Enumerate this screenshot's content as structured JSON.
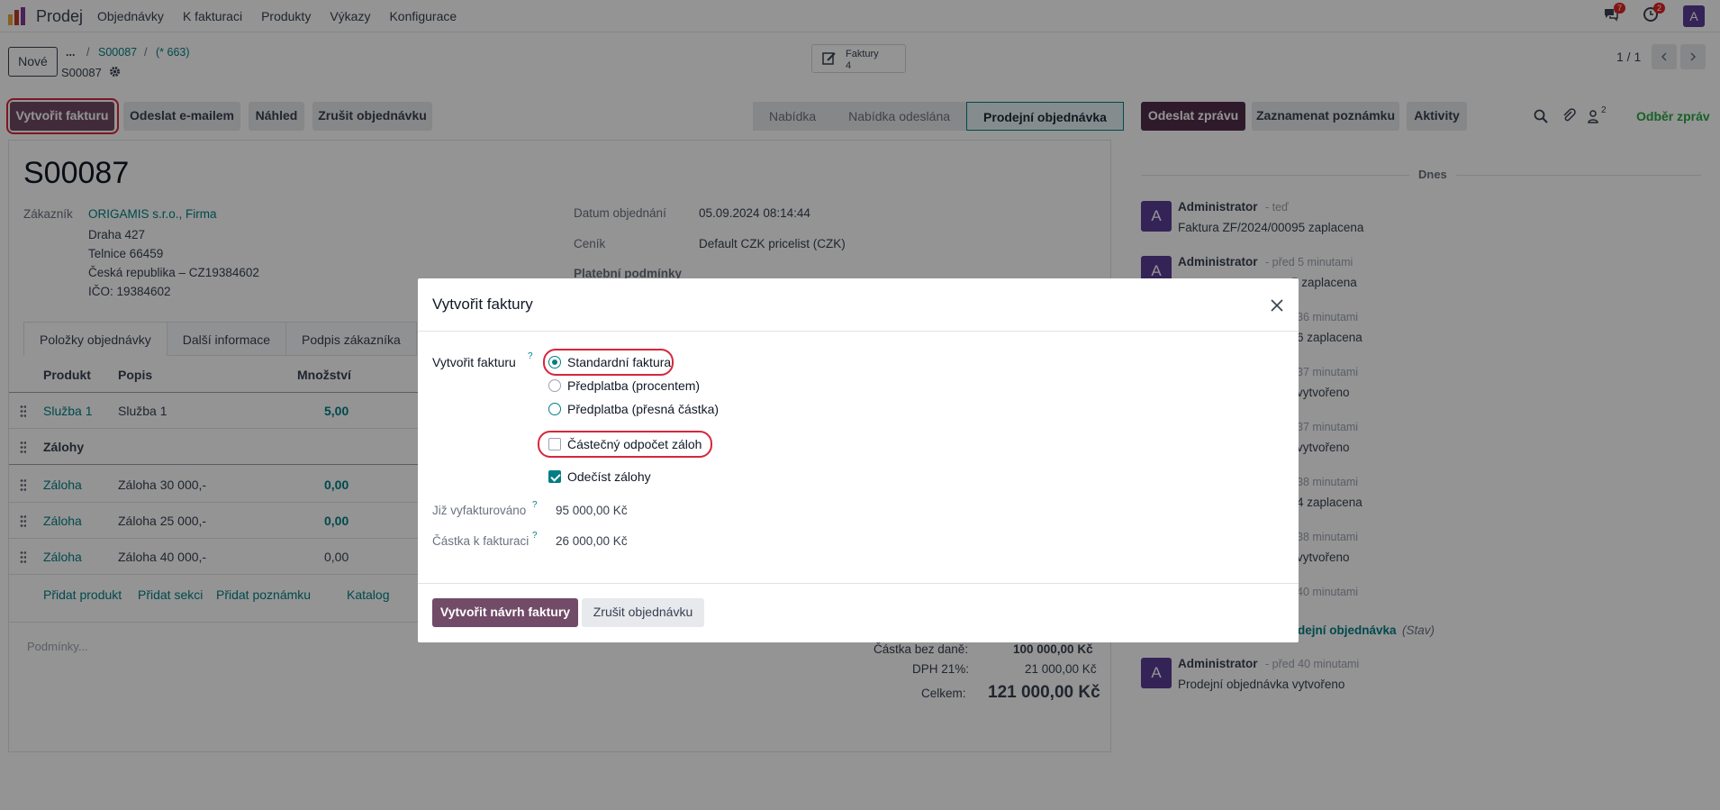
{
  "navbar": {
    "app_name": "Prodej",
    "menu": [
      "Objednávky",
      "K fakturaci",
      "Produkty",
      "Výkazy",
      "Konfigurace"
    ],
    "messages_count": "7",
    "activities_count": "2",
    "user_initial": "A"
  },
  "control": {
    "new_button": "Nové",
    "breadcrumb_ellipsis": "...",
    "breadcrumb_sep": "/",
    "breadcrumb_order": "S00087",
    "breadcrumb_count": "(* 663)",
    "record_name": "S00087",
    "invoices_label": "Faktury",
    "invoices_count": "4",
    "pager": "1 / 1"
  },
  "actions": {
    "create_invoice": "Vytvořit fakturu",
    "send_email": "Odeslat e-mailem",
    "preview": "Náhled",
    "cancel_order": "Zrušit objednávku"
  },
  "statusbar": [
    "Nabídka",
    "Nabídka odeslána",
    "Prodejní objednávka"
  ],
  "form": {
    "title": "S00087",
    "customer_label": "Zákazník",
    "customer_name": "ORIGAMIS s.r.o., Firma",
    "address_lines": [
      "Draha 427",
      "Telnice 66459",
      "Česká republika – CZ19384602",
      "IČO: 19384602"
    ],
    "order_date_label": "Datum objednání",
    "order_date": "05.09.2024 08:14:44",
    "pricelist_label": "Ceník",
    "pricelist": "Default CZK pricelist (CZK)",
    "payment_terms_label": "Platební podmínky",
    "tabs": [
      "Položky objednávky",
      "Další informace",
      "Podpis zákazníka"
    ],
    "columns": [
      "Produkt",
      "Popis",
      "Množství"
    ],
    "lines": [
      {
        "product": "Služba 1",
        "desc": "Služba 1",
        "qty": "5,00"
      },
      {
        "section": "Zálohy"
      },
      {
        "product": "Záloha",
        "desc": "Záloha 30 000,-",
        "qty": "0,00"
      },
      {
        "product": "Záloha",
        "desc": "Záloha 25 000,-",
        "qty": "0,00"
      },
      {
        "product": "Záloha",
        "desc": "Záloha 40 000,-",
        "qty": "0,00"
      }
    ],
    "add_links": [
      "Přidat produkt",
      "Přidat sekci",
      "Přidat poznámku",
      "Katalog"
    ],
    "terms_placeholder": "Podmínky...",
    "untaxed_label": "Částka bez daně:",
    "untaxed": "100 000,00 Kč",
    "tax_label": "DPH 21%:",
    "tax": "21 000,00 Kč",
    "total_label": "Celkem:",
    "total": "121 000,00 Kč"
  },
  "chatter": {
    "send_message": "Odeslat zprávu",
    "log_note": "Zaznamenat poznámku",
    "activities": "Aktivity",
    "followers_count": "2",
    "follow": "Odběr zpráv",
    "date_separator": "Dnes",
    "messages": [
      {
        "author": "Administrator",
        "time": "- teď",
        "body": "Faktura ZF/2024/00095 zaplacena"
      },
      {
        "author": "Administrator",
        "time": "- před 5 minutami",
        "body": "5 zaplacena"
      },
      {
        "author": "",
        "time": "36 minutami",
        "body": "6 zaplacena"
      },
      {
        "author": "",
        "time": "37 minutami",
        "body": "vytvořeno"
      },
      {
        "author": "",
        "time": "37 minutami",
        "body": "vytvořeno"
      },
      {
        "author": "",
        "time": "38 minutami",
        "body": "4 zaplacena"
      },
      {
        "author": "",
        "time": "38 minutami",
        "body": "vytvořeno"
      },
      {
        "author": "",
        "time": "40 minutami",
        "body": ""
      }
    ],
    "state_change": "dejní objednávka",
    "state_field": "(Stav)",
    "last_author": "Administrator",
    "last_time": "- před 40 minutami",
    "last_body": "Prodejní objednávka vytvořeno"
  },
  "modal": {
    "title": "Vytvořit faktury",
    "field_label": "Vytvořit fakturu",
    "options": [
      "Standardní faktura",
      "Předplatba (procentem)",
      "Předplatba (přesná částka)"
    ],
    "partial_deduct": "Částečný odpočet záloh",
    "deduct": "Odečíst zálohy",
    "already_invoiced_label": "Již vyfakturováno",
    "already_invoiced": "95 000,00 Kč",
    "to_invoice_label": "Částka k fakturaci",
    "to_invoice": "26 000,00 Kč",
    "create_draft": "Vytvořit návrh faktury",
    "cancel": "Zrušit objednávku",
    "help_mark": "?"
  },
  "colors": {
    "primary": "#714b67",
    "teal": "#017e84",
    "highlight": "#d7263d"
  }
}
